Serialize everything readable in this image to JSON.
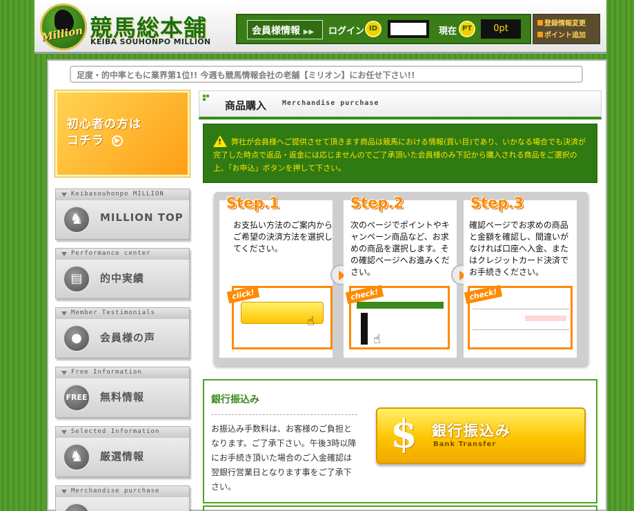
{
  "header": {
    "logo_title": "競馬総本舗",
    "logo_subtitle": "KEIBA SOUHONPO MILLION",
    "logo_emblem_text": "Million",
    "member_info_label": "会員様情報",
    "login_label": "ログイン",
    "id_badge": "ID",
    "now_label": "現在",
    "pt_badge": "PT",
    "points_value": "0pt",
    "side_links": [
      "登録情報変更",
      "ポイント追加"
    ]
  },
  "marquee": "足度・的中率ともに業界第1位!! 今週も競馬情報会社の老舗【ミリオン】にお任せ下さい!!",
  "sidebar": {
    "beginner_lines": [
      "初心者の方は",
      "コチラ"
    ],
    "nav": [
      {
        "caption": "Keibasouhonpo MILLION",
        "label": "MILLION TOP",
        "icon": "horse-icon",
        "glyph": "♞"
      },
      {
        "caption": "Performance center",
        "label": "的中実績",
        "icon": "document-icon",
        "glyph": "▤"
      },
      {
        "caption": "Member Testimonials",
        "label": "会員様の声",
        "icon": "person-icon",
        "glyph": "●"
      },
      {
        "caption": "Free Information",
        "label": "無料情報",
        "icon": "free-icon",
        "glyph": "FREE"
      },
      {
        "caption": "Selected Information",
        "label": "厳選情報",
        "icon": "horse-icon",
        "glyph": "♞"
      },
      {
        "caption": "Merchandise purchase",
        "label": "",
        "icon": "cart-icon",
        "glyph": ""
      }
    ]
  },
  "section": {
    "title": "商品購入",
    "subtitle": "Merchandise purchase"
  },
  "notice": "弊社が会員様へご提供させて頂きます商品は競馬における情報(買い目)であり、いかなる場合でも決済が完了した時点で返品・返金には応じませんのでご了承頂いた会員様のみ下記から購入される商品をご選択の上、「お申込」ボタンを押して下さい。",
  "steps": [
    {
      "title": "Step.1",
      "text": "お支払い方法のご案内からご希望の決済方法を選択してください。",
      "tag": "click!"
    },
    {
      "title": "Step.2",
      "text": "次のページでポイントやキャンペーン商品など、お求めの商品を選択します。その確認ページへお進みください。",
      "tag": "check!"
    },
    {
      "title": "Step.3",
      "text": "確認ページでお求めの商品と金額を確認し、間違いがなければ口座へ入金、またはクレジットカード決済でお手続きください。",
      "tag": "check!"
    }
  ],
  "bank": {
    "title": "銀行振込み",
    "description": "お振込み手数料は、お客様のご負担となります。ご了承下さい。午後3時以降にお手続き頂いた場合のご入金確認は翌銀行営業日となります事をご了承下さい。",
    "button_label": "銀行振込み",
    "button_sub": "Bank Transfer",
    "button_symbol": "$"
  }
}
